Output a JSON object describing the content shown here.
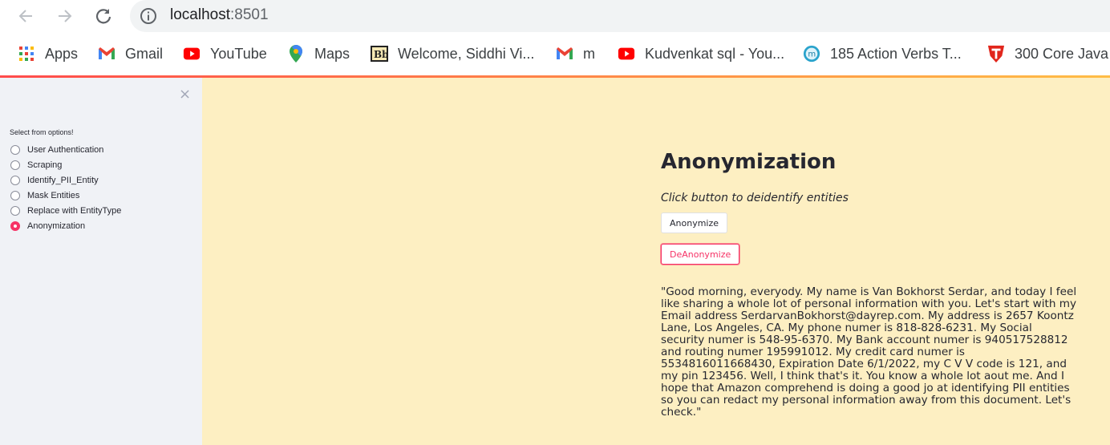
{
  "browser": {
    "url_host": "localhost",
    "url_port": ":8501",
    "bookmarks": [
      {
        "label": "Apps",
        "icon": "apps-grid-icon"
      },
      {
        "label": "Gmail",
        "icon": "gmail-icon"
      },
      {
        "label": "YouTube",
        "icon": "youtube-icon"
      },
      {
        "label": "Maps",
        "icon": "maps-pin-icon"
      },
      {
        "label": "Welcome, Siddhi Vi...",
        "icon": "blackboard-icon"
      },
      {
        "label": "m",
        "icon": "gmail-icon"
      },
      {
        "label": "Kudvenkat sql - You...",
        "icon": "youtube-icon"
      },
      {
        "label": "185 Action Verbs T...",
        "icon": "m-circle-icon"
      },
      {
        "label": "300 Core Java",
        "icon": "t-shield-icon"
      }
    ]
  },
  "sidebar": {
    "close_symbol": "×",
    "radio_label": "Select from options!",
    "options": [
      {
        "label": "User Authentication",
        "checked": false
      },
      {
        "label": "Scraping",
        "checked": false
      },
      {
        "label": "Identify_PII_Entity",
        "checked": false
      },
      {
        "label": "Mask Entities",
        "checked": false
      },
      {
        "label": "Replace with EntityType",
        "checked": false
      },
      {
        "label": "Anonymization",
        "checked": true
      }
    ]
  },
  "main": {
    "title": "Anonymization",
    "subtitle": "Click button to deidentify entities",
    "anonymize_button": "Anonymize",
    "deanonymize_button": "DeAnonymize",
    "text_lines": [
      "\"Good morning, everyody. My name is Van Bokhorst Serdar, and today I feel",
      "like sharing a whole lot of personal information with you. Let's start with my",
      "Email address SerdarvanBokhorst@dayrep.com. My address is 2657 Koontz",
      "Lane, Los Angeles, CA. My phone numer is 818-828-6231. My Social",
      "security numer is 548-95-6370. My Bank account numer is 940517528812",
      "and routing numer 195991012. My credit card numer is",
      "5534816011668430, Expiration Date 6/1/2022, my C V V code is 121, and",
      "my pin 123456. Well, I think that's it. You know a whole lot aout me. And I",
      "hope that Amazon comprehend is doing a good jo at identifying PII entities",
      "so you can redact my personal information away from this document. Let's",
      "check.\""
    ]
  },
  "colors": {
    "main_bg": "#fdefc2",
    "sidebar_bg": "#f0f2f6",
    "accent": "#f63366"
  }
}
